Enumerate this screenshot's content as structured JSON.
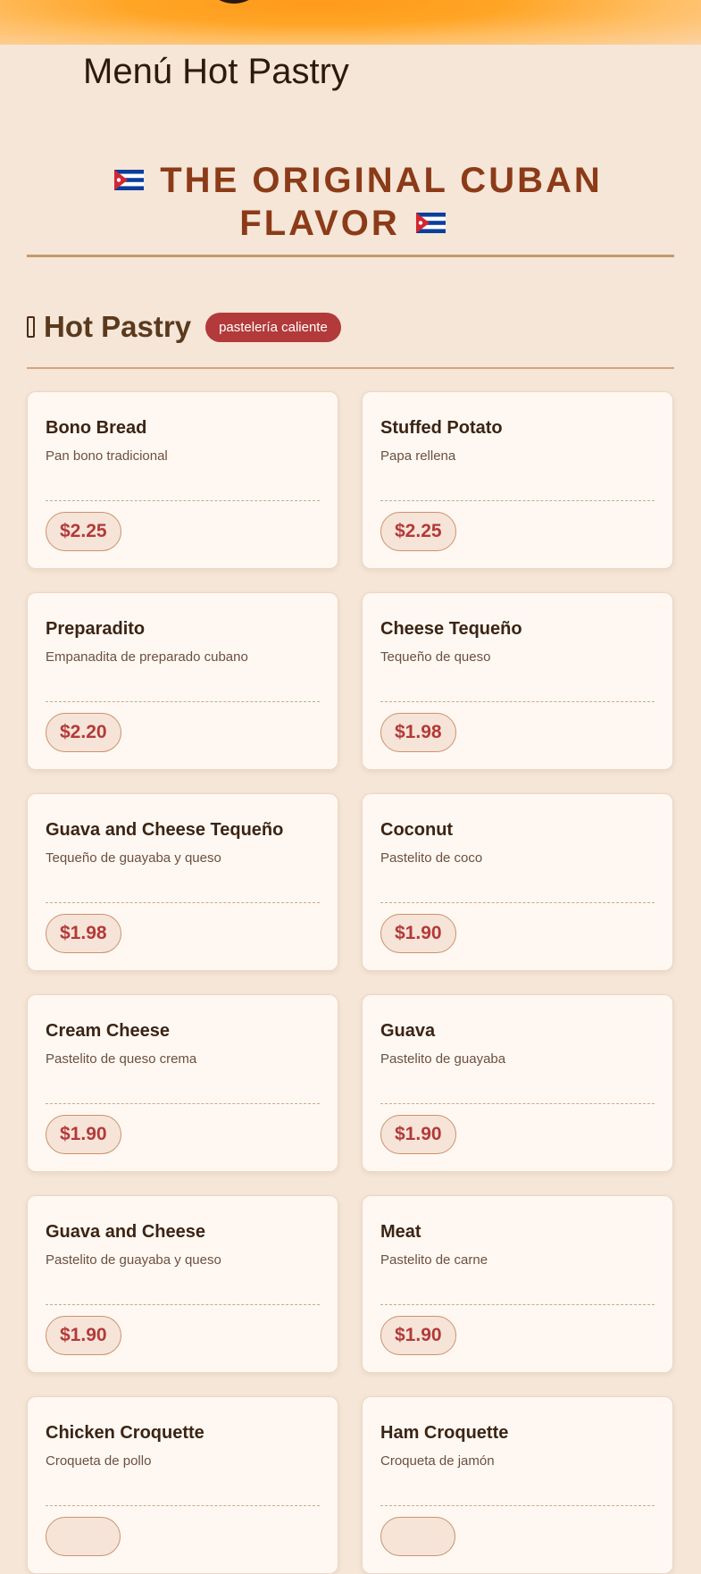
{
  "header": {
    "title": "Menú Hot Pastry",
    "tagline": "THE ORIGINAL CUBAN FLAVOR"
  },
  "icons": {
    "flag_left": "cuban-flag",
    "flag_right": "cuban-flag",
    "section_icon": "missing-glyph-icon"
  },
  "section": {
    "title": "Hot Pastry",
    "badge": "pastelería caliente"
  },
  "items": [
    {
      "name": "Bono Bread",
      "desc": "Pan bono tradicional",
      "price": "$2.25"
    },
    {
      "name": "Stuffed Potato",
      "desc": "Papa rellena",
      "price": "$2.25"
    },
    {
      "name": "Preparadito",
      "desc": "Empanadita de preparado cubano",
      "price": "$2.20"
    },
    {
      "name": "Cheese Tequeño",
      "desc": "Tequeño de queso",
      "price": "$1.98"
    },
    {
      "name": "Guava and Cheese Tequeño",
      "desc": "Tequeño de guayaba y queso",
      "price": "$1.98"
    },
    {
      "name": "Coconut",
      "desc": "Pastelito de coco",
      "price": "$1.90"
    },
    {
      "name": "Cream Cheese",
      "desc": "Pastelito de queso crema",
      "price": "$1.90"
    },
    {
      "name": "Guava",
      "desc": "Pastelito de guayaba",
      "price": "$1.90"
    },
    {
      "name": "Guava and Cheese",
      "desc": "Pastelito de guayaba y queso",
      "price": "$1.90"
    },
    {
      "name": "Meat",
      "desc": "Pastelito de carne",
      "price": "$1.90"
    },
    {
      "name": "Chicken Croquette",
      "desc": "Croqueta de pollo",
      "price": ""
    },
    {
      "name": "Ham Croquette",
      "desc": "Croqueta de jamón",
      "price": ""
    }
  ],
  "colors": {
    "background": "#f5e6d7",
    "accent": "#8c3b18",
    "badge": "#b23a3a",
    "price": "#b33a3a"
  }
}
